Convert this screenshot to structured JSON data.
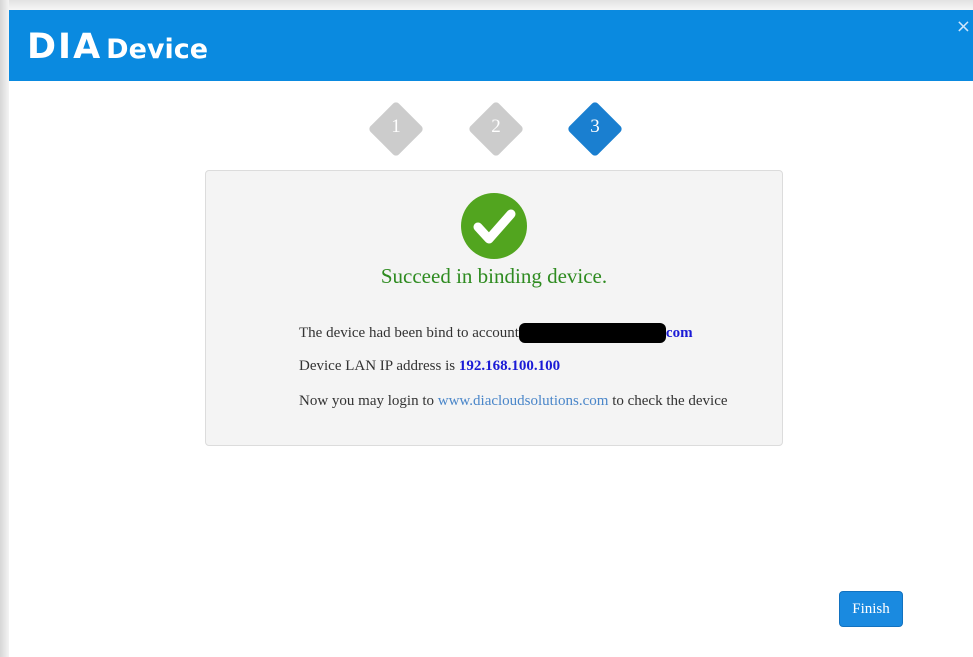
{
  "header": {
    "logo_part1": "DIA",
    "logo_part2": "Device",
    "close_glyph": "×"
  },
  "steps": [
    {
      "label": "1",
      "state": "inactive"
    },
    {
      "label": "2",
      "state": "inactive"
    },
    {
      "label": "3",
      "state": "active"
    }
  ],
  "result": {
    "icon": "check-circle-icon",
    "message": "Succeed in binding device.",
    "account_prefix": "The device had been bind to account",
    "account_suffix": "com",
    "lan_prefix": "Device LAN IP address is ",
    "lan_ip": "192.168.100.100",
    "login_prefix": "Now you may login to ",
    "login_link": "www.diacloudsolutions.com",
    "login_suffix": " to check the device"
  },
  "footer": {
    "finish_label": "Finish"
  },
  "colors": {
    "header_bg": "#0a8ae0",
    "step_active": "#1a7fd0",
    "step_inactive": "#cccccc",
    "success": "#2e8b20",
    "check_bg": "#52a51f"
  }
}
